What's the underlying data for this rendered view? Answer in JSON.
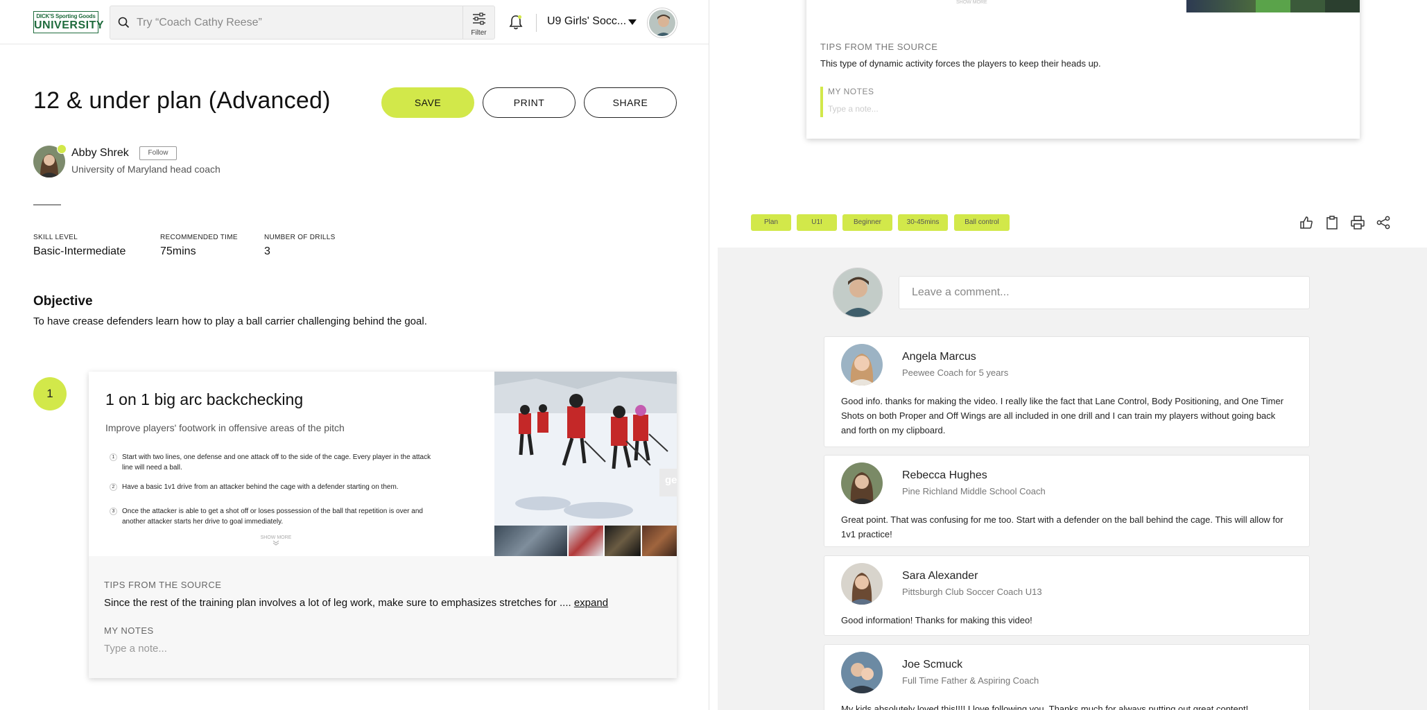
{
  "brand": {
    "logo_line1": "DICK'S Sporting Goods",
    "logo_line2": "UNIVERSITY"
  },
  "header": {
    "search_placeholder": "Try “Coach Cathy Reese”",
    "filter_label": "Filter",
    "team_selector": "U9 Girls' Socc..."
  },
  "plan": {
    "title": "12 & under plan (Advanced)",
    "save_label": "SAVE",
    "print_label": "PRINT",
    "share_label": "SHARE",
    "author": {
      "name": "Abby Shrek",
      "follow_label": "Follow",
      "role": "University of Maryland head coach"
    },
    "stats": [
      {
        "label": "SKILL LEVEL",
        "value": "Basic-Intermediate"
      },
      {
        "label": "RECOMMENDED TIME",
        "value": "75mins"
      },
      {
        "label": "NUMBER OF DRILLS",
        "value": "3"
      }
    ],
    "objective_heading": "Objective",
    "objective_text": "To have crease defenders learn how to play a ball carrier challenging behind the goal."
  },
  "drill": {
    "number": "1",
    "title": "1 on 1 big arc backchecking",
    "subtitle": "Improve players' footwork in offensive areas of the pitch",
    "steps": [
      {
        "n": "1",
        "text": "Start with two lines, one defense and one attack off to the side of the cage. Every player in the attack line will need a ball."
      },
      {
        "n": "2",
        "text": "Have a basic 1v1 drive from an attacker behind the cage with a defender starting on them."
      },
      {
        "n": "3",
        "text": "Once the attacker is able to get a shot off or loses possession of the ball that repetition is over and another attacker starts her drive to goal immediately."
      }
    ],
    "show_more": "SHOW MORE",
    "image_overlay": "ge",
    "tips_label": "TIPS FROM THE SOURCE",
    "tips_text": "Since the rest of the training plan involves a lot of leg work, make sure to emphasizes stretches for ....",
    "tips_expand": "expand",
    "notes_label": "MY NOTES",
    "notes_placeholder": "Type a note..."
  },
  "right_card": {
    "show_more": "SHOW MORE",
    "tips_label": "TIPS FROM THE SOURCE",
    "tips_text": "This type of dynamic activity forces the players to keep their heads up.",
    "notes_label": "MY NOTES",
    "notes_placeholder": "Type a note..."
  },
  "tags": [
    "Plan",
    "U1I",
    "Beginner",
    "30-45mins",
    "Ball control"
  ],
  "action_icons": [
    "thumbs-up-icon",
    "clipboard-icon",
    "print-icon",
    "share-icon"
  ],
  "comments_section": {
    "input_placeholder": "Leave a comment...",
    "comments": [
      {
        "name": "Angela Marcus",
        "role": "Peewee Coach for 5 years",
        "text": "Good info. thanks for making the video. I really like the fact that Lane Control, Body Positioning, and One Timer Shots on both Proper and Off Wings are all included in one drill and I can train my players without going back and forth on my clipboard."
      },
      {
        "name": "Rebecca Hughes",
        "role": "Pine Richland Middle School Coach",
        "text": "Great point. That was confusing for me too.  Start with a defender on the ball behind the cage. This will allow for 1v1 practice!"
      },
      {
        "name": "Sara Alexander",
        "role": "Pittsburgh Club Soccer Coach U13",
        "text": "Good information! Thanks for making this video!"
      },
      {
        "name": "Joe Scmuck",
        "role": "Full Time Father & Aspiring Coach",
        "text": "My kids absolutely loved this!!!! I love following you. Thanks much for always putting out great content!"
      }
    ]
  },
  "colors": {
    "accent": "#d2e84a",
    "brand_green": "#1e6b3c"
  }
}
